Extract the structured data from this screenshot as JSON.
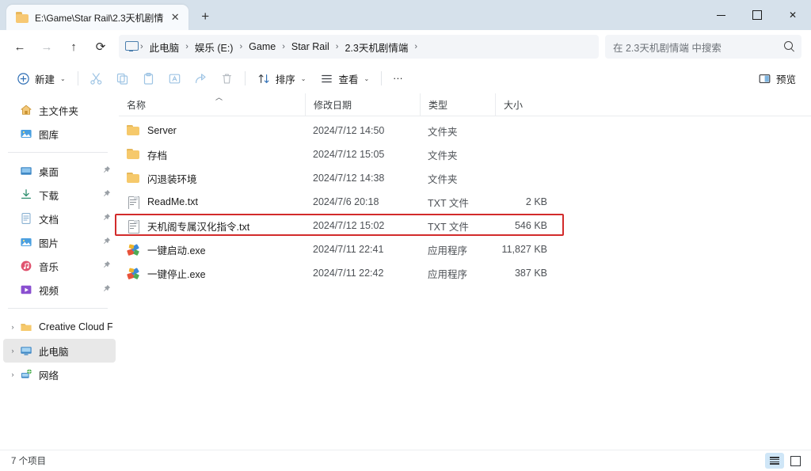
{
  "window": {
    "tab_title": "E:\\Game\\Star Rail\\2.3天机剧情",
    "tab_close_label": "✕",
    "new_tab_label": "+",
    "minimize_label": "",
    "maximize_label": "",
    "close_label": "✕"
  },
  "address_bar": {
    "back_label": "←",
    "forward_label": "→",
    "up_label": "↑",
    "refresh_label": "⟳",
    "breadcrumbs": [
      {
        "label": "此电脑"
      },
      {
        "label": "娱乐 (E:)"
      },
      {
        "label": "Game"
      },
      {
        "label": "Star Rail"
      },
      {
        "label": "2.3天机剧情端"
      }
    ],
    "separator": "›",
    "search_placeholder": "在 2.3天机剧情端 中搜索"
  },
  "command_bar": {
    "new_label": "新建",
    "cut_label": "剪切",
    "copy_label": "复制",
    "paste_label": "粘贴",
    "rename_label": "重命名",
    "share_label": "共享",
    "delete_label": "删除",
    "sort_label": "排序",
    "view_label": "查看",
    "more_label": "···",
    "preview_label": "预览",
    "caret": "⌄"
  },
  "sidebar": {
    "quick": [
      {
        "label": "主文件夹",
        "icon": "home-icon",
        "pinned": false,
        "expandable": false
      },
      {
        "label": "图库",
        "icon": "gallery-icon",
        "pinned": false,
        "expandable": false
      }
    ],
    "pinned": [
      {
        "label": "桌面",
        "icon": "desktop-icon",
        "pinned": true
      },
      {
        "label": "下载",
        "icon": "downloads-icon",
        "pinned": true
      },
      {
        "label": "文档",
        "icon": "documents-icon",
        "pinned": true
      },
      {
        "label": "图片",
        "icon": "pictures-icon",
        "pinned": true
      },
      {
        "label": "音乐",
        "icon": "music-icon",
        "pinned": true
      },
      {
        "label": "视频",
        "icon": "videos-icon",
        "pinned": true
      }
    ],
    "trees": [
      {
        "label": "Creative Cloud Fil",
        "icon": "folder-icon",
        "selected": false
      },
      {
        "label": "此电脑",
        "icon": "this-pc-icon",
        "selected": true
      },
      {
        "label": "网络",
        "icon": "network-icon",
        "selected": false
      }
    ],
    "chevron": "›",
    "pin_glyph": "📌"
  },
  "file_list": {
    "columns": {
      "name": "名称",
      "date": "修改日期",
      "type": "类型",
      "size": "大小"
    },
    "sort_caret": "︿",
    "rows": [
      {
        "name": "Server",
        "date": "2024/7/12 14:50",
        "type": "文件夹",
        "size": "",
        "icon": "folder",
        "highlighted": false
      },
      {
        "name": "存档",
        "date": "2024/7/12 15:05",
        "type": "文件夹",
        "size": "",
        "icon": "folder",
        "highlighted": false
      },
      {
        "name": "闪退装环境",
        "date": "2024/7/12 14:38",
        "type": "文件夹",
        "size": "",
        "icon": "folder",
        "highlighted": false
      },
      {
        "name": "ReadMe.txt",
        "date": "2024/7/6 20:18",
        "type": "TXT 文件",
        "size": "2 KB",
        "icon": "txt",
        "highlighted": false
      },
      {
        "name": "天机阁专属汉化指令.txt",
        "date": "2024/7/12 15:02",
        "type": "TXT 文件",
        "size": "546 KB",
        "icon": "txt",
        "highlighted": false
      },
      {
        "name": "一键启动.exe",
        "date": "2024/7/11 22:41",
        "type": "应用程序",
        "size": "11,827 KB",
        "icon": "exe",
        "highlighted": true
      },
      {
        "name": "一键停止.exe",
        "date": "2024/7/11 22:42",
        "type": "应用程序",
        "size": "387 KB",
        "icon": "exe",
        "highlighted": false
      }
    ]
  },
  "status_bar": {
    "item_count": "7 个项目",
    "details_view_label": "详细信息",
    "large_icons_view_label": "大图标"
  },
  "colors": {
    "titlebar": "#d6e1eb",
    "tab_active": "#f7fafd",
    "highlight_red": "#d22b2b",
    "selected_nav": "#e8e8e8",
    "view_active": "#cfe6f7"
  }
}
